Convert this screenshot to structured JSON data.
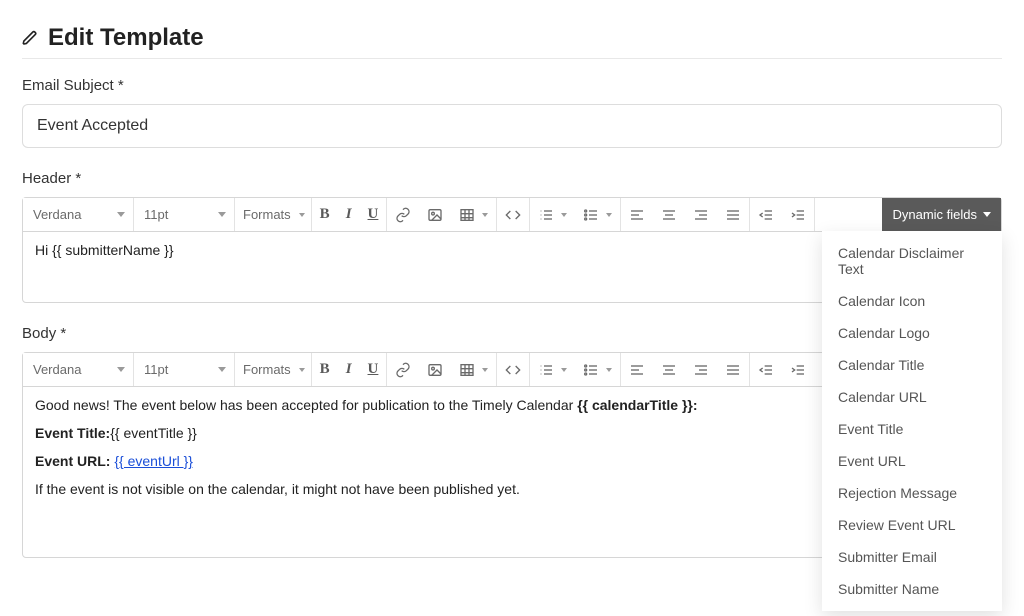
{
  "page": {
    "title": "Edit Template"
  },
  "emailSubject": {
    "label": "Email Subject *",
    "value": "Event Accepted"
  },
  "header": {
    "label": "Header *"
  },
  "body": {
    "label": "Body *"
  },
  "toolbar": {
    "font": "Verdana",
    "size": "11pt",
    "formats": "Formats",
    "dynamic_label": "Dynamic fields"
  },
  "dynamic_fields": [
    "Calendar Disclaimer Text",
    "Calendar Icon",
    "Calendar Logo",
    "Calendar Title",
    "Calendar URL",
    "Event Title",
    "Event URL",
    "Rejection Message",
    "Review Event URL",
    "Submitter Email",
    "Submitter Name"
  ],
  "header_content": {
    "line1": "Hi {{ submitterName }}"
  },
  "body_content": {
    "intro_pre": "Good news! The event below has been accepted for publication to the Timely Calendar ",
    "intro_bold": "{{ calendarTitle }}:",
    "event_title_label": "Event Title:",
    "event_title_value": "{{ eventTitle }}",
    "event_url_label": "Event URL:",
    "event_url_value": "{{ eventUrl }}",
    "note": "If the event is not visible on the calendar, it might not have been published yet."
  }
}
